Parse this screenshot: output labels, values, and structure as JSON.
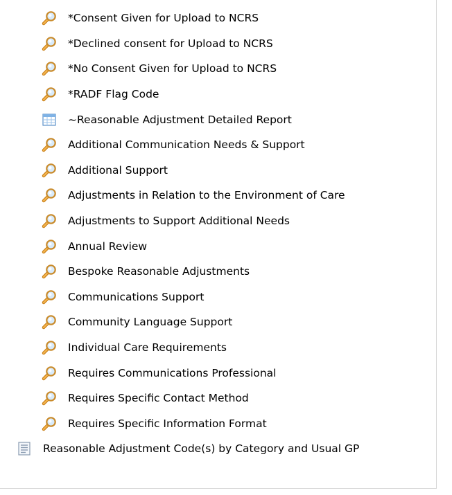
{
  "tree": {
    "items": [
      {
        "label": "*Consent Given for Upload to NCRS",
        "icon": "magnifier-icon",
        "level": 1
      },
      {
        "label": "*Declined consent for Upload to NCRS",
        "icon": "magnifier-icon",
        "level": 1
      },
      {
        "label": "*No Consent Given for Upload to NCRS",
        "icon": "magnifier-icon",
        "level": 1
      },
      {
        "label": "*RADF Flag Code",
        "icon": "magnifier-icon",
        "level": 1
      },
      {
        "label": "~Reasonable Adjustment Detailed Report",
        "icon": "table-icon",
        "level": 1
      },
      {
        "label": "Additional Communication Needs & Support",
        "icon": "magnifier-icon",
        "level": 1
      },
      {
        "label": "Additional Support",
        "icon": "magnifier-icon",
        "level": 1
      },
      {
        "label": "Adjustments in Relation to the Environment of Care",
        "icon": "magnifier-icon",
        "level": 1
      },
      {
        "label": "Adjustments to Support Additional Needs",
        "icon": "magnifier-icon",
        "level": 1
      },
      {
        "label": "Annual Review",
        "icon": "magnifier-icon",
        "level": 1
      },
      {
        "label": "Bespoke Reasonable Adjustments",
        "icon": "magnifier-icon",
        "level": 1
      },
      {
        "label": "Communications Support",
        "icon": "magnifier-icon",
        "level": 1
      },
      {
        "label": "Community Language Support",
        "icon": "magnifier-icon",
        "level": 1
      },
      {
        "label": "Individual Care Requirements",
        "icon": "magnifier-icon",
        "level": 1
      },
      {
        "label": "Requires Communications Professional",
        "icon": "magnifier-icon",
        "level": 1
      },
      {
        "label": "Requires Specific Contact Method",
        "icon": "magnifier-icon",
        "level": 1
      },
      {
        "label": "Requires Specific Information Format",
        "icon": "magnifier-icon",
        "level": 1
      },
      {
        "label": "Reasonable Adjustment Code(s) by Category and Usual GP",
        "icon": "report-icon",
        "level": 0
      }
    ]
  },
  "colors": {
    "magnifier_lens": "#6fa8dc",
    "magnifier_handle": "#e8a33c",
    "table_header": "#7fb2e5",
    "table_grid": "#5b8fc7",
    "report_lines": "#8a9bb0"
  }
}
